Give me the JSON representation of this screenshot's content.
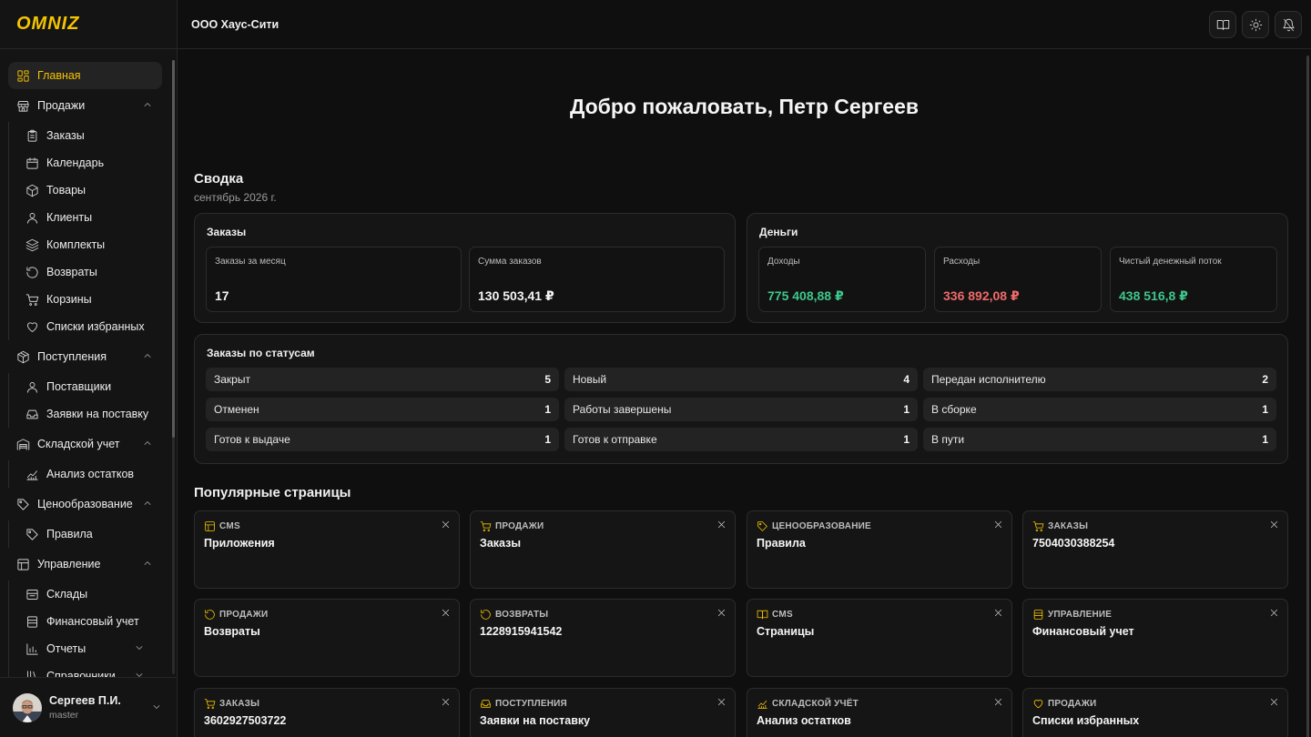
{
  "app": {
    "logo": "OMNIZ",
    "company": "ООО Хаус-Сити"
  },
  "sidebar": {
    "items": [
      {
        "label": "Главная",
        "icon": "dashboard-icon",
        "active": true
      },
      {
        "label": "Продажи",
        "icon": "store-icon",
        "expanded": true,
        "children": [
          {
            "label": "Заказы",
            "icon": "clipboard-icon"
          },
          {
            "label": "Календарь",
            "icon": "calendar-icon"
          },
          {
            "label": "Товары",
            "icon": "box-icon"
          },
          {
            "label": "Клиенты",
            "icon": "user-icon"
          },
          {
            "label": "Комплекты",
            "icon": "layers-icon"
          },
          {
            "label": "Возвраты",
            "icon": "return-icon"
          },
          {
            "label": "Корзины",
            "icon": "cart-icon"
          },
          {
            "label": "Списки избранных",
            "icon": "heart-icon"
          }
        ]
      },
      {
        "label": "Поступления",
        "icon": "package-icon",
        "expanded": true,
        "children": [
          {
            "label": "Поставщики",
            "icon": "user-icon"
          },
          {
            "label": "Заявки на поставку",
            "icon": "inbox-icon"
          }
        ]
      },
      {
        "label": "Складской учет",
        "icon": "warehouse-icon",
        "expanded": true,
        "children": [
          {
            "label": "Анализ остатков",
            "icon": "chart-line-icon"
          }
        ]
      },
      {
        "label": "Ценообразование",
        "icon": "tag-icon",
        "expanded": true,
        "children": [
          {
            "label": "Правила",
            "icon": "tag-icon"
          }
        ]
      },
      {
        "label": "Управление",
        "icon": "layout-icon",
        "expanded": true,
        "children": [
          {
            "label": "Склады",
            "icon": "folder-icon"
          },
          {
            "label": "Финансовый учет",
            "icon": "finance-icon"
          },
          {
            "label": "Отчеты",
            "icon": "bar-chart-icon",
            "has_children": true
          },
          {
            "label": "Справочники",
            "icon": "library-icon",
            "has_children": true
          }
        ]
      }
    ]
  },
  "user": {
    "name": "Сергеев П.И.",
    "role": "master"
  },
  "main": {
    "welcome": "Добро пожаловать, Петр Сергеев",
    "summary_title": "Сводка",
    "summary_period": "сентябрь 2026 г.",
    "orders_card": {
      "title": "Заказы",
      "stats": [
        {
          "label": "Заказы за месяц",
          "value": "17"
        },
        {
          "label": "Сумма заказов",
          "value": "130 503,41 ₽"
        }
      ]
    },
    "money_card": {
      "title": "Деньги",
      "stats": [
        {
          "label": "Доходы",
          "value": "775 408,88 ₽",
          "color": "#3ec78c"
        },
        {
          "label": "Расходы",
          "value": "336 892,08 ₽",
          "color": "#f06a6a"
        },
        {
          "label": "Чистый денежный поток",
          "value": "438 516,8 ₽",
          "color": "#3ec78c"
        }
      ]
    },
    "status_card": {
      "title": "Заказы по статусам",
      "rows": [
        {
          "label": "Закрыт",
          "count": "5"
        },
        {
          "label": "Новый",
          "count": "4"
        },
        {
          "label": "Передан исполнителю",
          "count": "2"
        },
        {
          "label": "Отменен",
          "count": "1"
        },
        {
          "label": "Работы завершены",
          "count": "1"
        },
        {
          "label": "В сборке",
          "count": "1"
        },
        {
          "label": "Готов к выдаче",
          "count": "1"
        },
        {
          "label": "Готов к отправке",
          "count": "1"
        },
        {
          "label": "В пути",
          "count": "1"
        }
      ]
    },
    "popular_title": "Популярные страницы",
    "popular": [
      {
        "category": "CMS",
        "name": "Приложения",
        "icon": "layout-icon"
      },
      {
        "category": "ПРОДАЖИ",
        "name": "Заказы",
        "icon": "cart-icon"
      },
      {
        "category": "ЦЕНООБРАЗОВАНИЕ",
        "name": "Правила",
        "icon": "tag-icon"
      },
      {
        "category": "ЗАКАЗЫ",
        "name": "7504030388254",
        "icon": "cart-icon"
      },
      {
        "category": "ПРОДАЖИ",
        "name": "Возвраты",
        "icon": "return-icon"
      },
      {
        "category": "ВОЗВРАТЫ",
        "name": "1228915941542",
        "icon": "return-icon"
      },
      {
        "category": "CMS",
        "name": "Страницы",
        "icon": "book-icon"
      },
      {
        "category": "УПРАВЛЕНИЕ",
        "name": "Финансовый учет",
        "icon": "finance-icon"
      },
      {
        "category": "ЗАКАЗЫ",
        "name": "3602927503722",
        "icon": "cart-icon"
      },
      {
        "category": "ПОСТУПЛЕНИЯ",
        "name": "Заявки на поставку",
        "icon": "inbox-icon"
      },
      {
        "category": "СКЛАДСКОЙ УЧЁТ",
        "name": "Анализ остатков",
        "icon": "chart-line-icon"
      },
      {
        "category": "ПРОДАЖИ",
        "name": "Списки избранных",
        "icon": "heart-icon"
      }
    ]
  },
  "colors": {
    "accent": "#f5c400",
    "positive": "#3ec78c",
    "negative": "#f06a6a"
  }
}
